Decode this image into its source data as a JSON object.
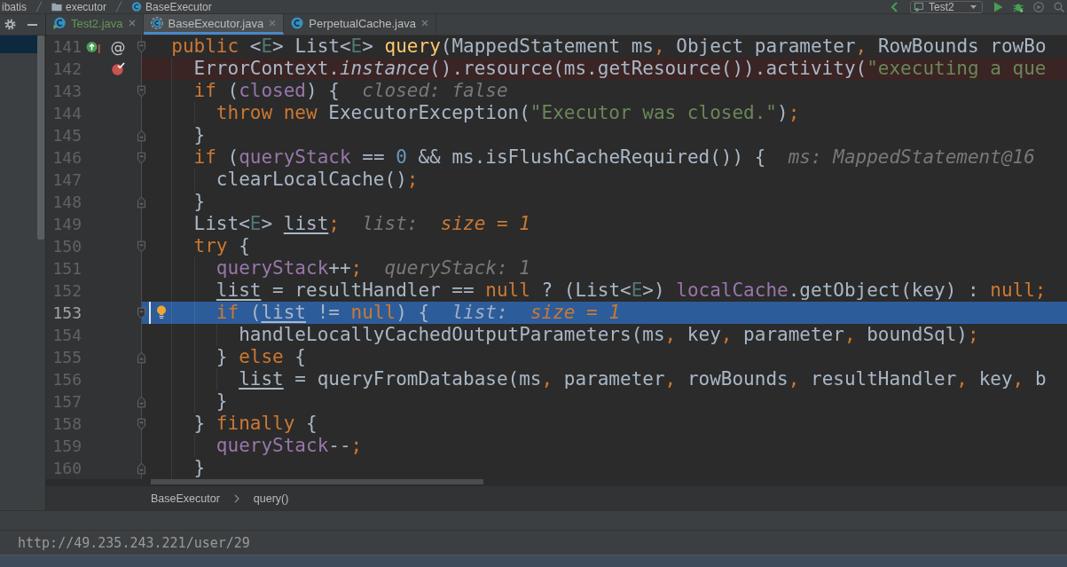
{
  "navigation_bar": {
    "breadcrumb": [
      {
        "kind": "plain",
        "label": "ibatis"
      },
      {
        "kind": "folder",
        "label": "executor"
      },
      {
        "kind": "class",
        "label": "BaseExecutor"
      }
    ],
    "run_config": {
      "label": "Test2"
    }
  },
  "tabs": [
    {
      "label": "Test2.java",
      "kind": "test",
      "selected": false,
      "color": "#629755"
    },
    {
      "label": "BaseExecutor.java",
      "kind": "abstract",
      "selected": true,
      "color": "#bbbbbb"
    },
    {
      "label": "PerpetualCache.java",
      "kind": "class",
      "selected": false,
      "color": "#bbbbbb"
    }
  ],
  "editor": {
    "lines": [
      {
        "number": "141",
        "breakpoint": false,
        "current": false,
        "fold": {
          "kind": "start"
        },
        "gutter_icons": [
          {
            "kind": "override"
          }
        ],
        "gutter_glyph": "@",
        "tokens": [
          {
            "kind": "kw",
            "text": "  public"
          },
          {
            "kind": "plain",
            "text": " <"
          },
          {
            "kind": "tparam",
            "text": "E"
          },
          {
            "kind": "plain",
            "text": "> List<"
          },
          {
            "kind": "tparam",
            "text": "E"
          },
          {
            "kind": "plain",
            "text": "> "
          },
          {
            "kind": "decl",
            "text": "query"
          },
          {
            "kind": "plain",
            "text": "(MappedStatement ms"
          },
          {
            "kind": "punc",
            "text": ", "
          },
          {
            "kind": "plain",
            "text": "Object parameter"
          },
          {
            "kind": "punc",
            "text": ", "
          },
          {
            "kind": "plain",
            "text": "RowBounds rowBo"
          }
        ]
      },
      {
        "number": "142",
        "breakpoint": true,
        "current": false,
        "tokens": [
          {
            "kind": "plain",
            "text": "    ErrorContext."
          },
          {
            "kind": "static",
            "text": "instance"
          },
          {
            "kind": "plain",
            "text": "().resource(ms.getResource()).activity("
          },
          {
            "kind": "str",
            "text": "\"executing a que"
          }
        ]
      },
      {
        "number": "143",
        "breakpoint": false,
        "current": false,
        "fold": {
          "kind": "start"
        },
        "tokens": [
          {
            "kind": "kw",
            "text": "    if"
          },
          {
            "kind": "plain",
            "text": " ("
          },
          {
            "kind": "field",
            "text": "closed"
          },
          {
            "kind": "plain",
            "text": ") {"
          }
        ],
        "hint": [
          {
            "kind": "name",
            "text": "closed: false"
          }
        ]
      },
      {
        "number": "144",
        "breakpoint": false,
        "current": false,
        "tokens": [
          {
            "kind": "kw",
            "text": "      throw new"
          },
          {
            "kind": "plain",
            "text": " ExecutorException("
          },
          {
            "kind": "str",
            "text": "\"Executor was closed.\""
          },
          {
            "kind": "plain",
            "text": ")"
          },
          {
            "kind": "punc",
            "text": ";"
          }
        ]
      },
      {
        "number": "145",
        "breakpoint": false,
        "current": false,
        "fold": {
          "kind": "end"
        },
        "tokens": [
          {
            "kind": "plain",
            "text": "    }"
          }
        ]
      },
      {
        "number": "146",
        "breakpoint": false,
        "current": false,
        "fold": {
          "kind": "start"
        },
        "tokens": [
          {
            "kind": "kw",
            "text": "    if"
          },
          {
            "kind": "plain",
            "text": " ("
          },
          {
            "kind": "field",
            "text": "queryStack"
          },
          {
            "kind": "plain",
            "text": " == "
          },
          {
            "kind": "num",
            "text": "0"
          },
          {
            "kind": "plain",
            "text": " && ms.isFlushCacheRequired()) {"
          }
        ],
        "hint": [
          {
            "kind": "name",
            "text": "ms: MappedStatement@16"
          }
        ]
      },
      {
        "number": "147",
        "breakpoint": false,
        "current": false,
        "tokens": [
          {
            "kind": "plain",
            "text": "      clearLocalCache()"
          },
          {
            "kind": "punc",
            "text": ";"
          }
        ]
      },
      {
        "number": "148",
        "breakpoint": false,
        "current": false,
        "fold": {
          "kind": "end"
        },
        "tokens": [
          {
            "kind": "plain",
            "text": "    }"
          }
        ]
      },
      {
        "number": "149",
        "breakpoint": false,
        "current": false,
        "tokens": [
          {
            "kind": "plain",
            "text": "    List<"
          },
          {
            "kind": "tparam",
            "text": "E"
          },
          {
            "kind": "plain",
            "text": "> "
          },
          {
            "kind": "reassigned",
            "text": "list"
          },
          {
            "kind": "punc",
            "text": ";"
          }
        ],
        "hint": [
          {
            "kind": "name",
            "text": "list:"
          },
          {
            "kind": "value",
            "text": "size = 1"
          }
        ]
      },
      {
        "number": "150",
        "breakpoint": false,
        "current": false,
        "fold": {
          "kind": "start"
        },
        "tokens": [
          {
            "kind": "kw",
            "text": "    try"
          },
          {
            "kind": "plain",
            "text": " {"
          }
        ]
      },
      {
        "number": "151",
        "breakpoint": false,
        "current": false,
        "tokens": [
          {
            "kind": "field",
            "text": "      queryStack"
          },
          {
            "kind": "plain",
            "text": "++"
          },
          {
            "kind": "punc",
            "text": ";"
          }
        ],
        "hint": [
          {
            "kind": "name",
            "text": "queryStack: 1"
          }
        ]
      },
      {
        "number": "152",
        "breakpoint": false,
        "current": false,
        "tokens": [
          {
            "kind": "reassigned",
            "text": "      list"
          },
          {
            "kind": "plain",
            "text": " = resultHandler == "
          },
          {
            "kind": "kw",
            "text": "null"
          },
          {
            "kind": "plain",
            "text": " ? (List<"
          },
          {
            "kind": "tparam",
            "text": "E"
          },
          {
            "kind": "plain",
            "text": ">) "
          },
          {
            "kind": "field",
            "text": "localCache"
          },
          {
            "kind": "plain",
            "text": ".getObject(key) : "
          },
          {
            "kind": "kw",
            "text": "null"
          },
          {
            "kind": "punc",
            "text": ";"
          }
        ]
      },
      {
        "number": "153",
        "breakpoint": false,
        "current": true,
        "fold": {
          "kind": "start"
        },
        "gutter_icons": [
          {
            "kind": "bulb"
          }
        ],
        "tokens": [
          {
            "kind": "kw",
            "text": "      if"
          },
          {
            "kind": "plain",
            "text": " ("
          },
          {
            "kind": "reassigned",
            "text": "list"
          },
          {
            "kind": "plain",
            "text": " != "
          },
          {
            "kind": "kw",
            "text": "null"
          },
          {
            "kind": "plain",
            "text": ") {"
          }
        ],
        "hint": [
          {
            "kind": "name",
            "text": "list:"
          },
          {
            "kind": "value",
            "text": "size = 1"
          }
        ]
      },
      {
        "number": "154",
        "breakpoint": false,
        "current": false,
        "tokens": [
          {
            "kind": "plain",
            "text": "        handleLocallyCachedOutputParameters(ms"
          },
          {
            "kind": "punc",
            "text": ", "
          },
          {
            "kind": "plain",
            "text": "key"
          },
          {
            "kind": "punc",
            "text": ", "
          },
          {
            "kind": "plain",
            "text": "parameter"
          },
          {
            "kind": "punc",
            "text": ", "
          },
          {
            "kind": "plain",
            "text": "boundSql)"
          },
          {
            "kind": "punc",
            "text": ";"
          }
        ]
      },
      {
        "number": "155",
        "breakpoint": false,
        "current": false,
        "fold": {
          "kind": "end"
        },
        "tokens": [
          {
            "kind": "plain",
            "text": "      } "
          },
          {
            "kind": "kw",
            "text": "else"
          },
          {
            "kind": "plain",
            "text": " {"
          }
        ]
      },
      {
        "number": "156",
        "breakpoint": false,
        "current": false,
        "tokens": [
          {
            "kind": "reassigned",
            "text": "        list"
          },
          {
            "kind": "plain",
            "text": " = queryFromDatabase(ms"
          },
          {
            "kind": "punc",
            "text": ", "
          },
          {
            "kind": "plain",
            "text": "parameter"
          },
          {
            "kind": "punc",
            "text": ", "
          },
          {
            "kind": "plain",
            "text": "rowBounds"
          },
          {
            "kind": "punc",
            "text": ", "
          },
          {
            "kind": "plain",
            "text": "resultHandler"
          },
          {
            "kind": "punc",
            "text": ", "
          },
          {
            "kind": "plain",
            "text": "key"
          },
          {
            "kind": "punc",
            "text": ", "
          },
          {
            "kind": "plain",
            "text": "b"
          }
        ]
      },
      {
        "number": "157",
        "breakpoint": false,
        "current": false,
        "fold": {
          "kind": "end"
        },
        "tokens": [
          {
            "kind": "plain",
            "text": "      }"
          }
        ]
      },
      {
        "number": "158",
        "breakpoint": false,
        "current": false,
        "fold": {
          "kind": "start"
        },
        "tokens": [
          {
            "kind": "plain",
            "text": "    } "
          },
          {
            "kind": "kw",
            "text": "finally"
          },
          {
            "kind": "plain",
            "text": " {"
          }
        ]
      },
      {
        "number": "159",
        "breakpoint": false,
        "current": false,
        "tokens": [
          {
            "kind": "field",
            "text": "      queryStack"
          },
          {
            "kind": "plain",
            "text": "--"
          },
          {
            "kind": "punc",
            "text": ";"
          }
        ]
      },
      {
        "number": "160",
        "breakpoint": false,
        "current": false,
        "fold": {
          "kind": "end"
        },
        "tokens": [
          {
            "kind": "plain",
            "text": "    }"
          }
        ]
      }
    ],
    "breadcrumb": [
      "BaseExecutor",
      "query()"
    ]
  },
  "status_text": "http://49.235.243.221/user/29"
}
